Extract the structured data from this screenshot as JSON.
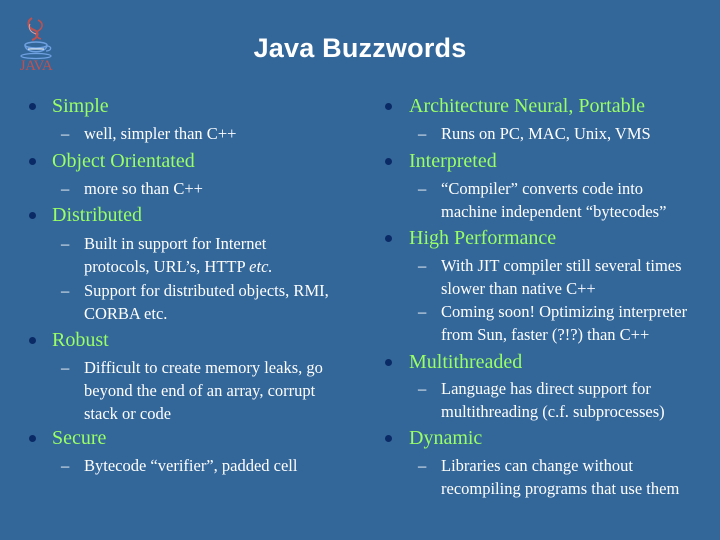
{
  "slide": {
    "title": "Java Buzzwords",
    "logo_text": "JAVA",
    "colors": {
      "background": "#336699",
      "heading": "#99ff66",
      "body": "#ffffff",
      "bullet": "#0a2a66"
    }
  },
  "left_column": [
    {
      "heading": "Simple",
      "subitems": [
        "well, simpler than C++"
      ]
    },
    {
      "heading": "Object Orientated",
      "subitems": [
        "more so than C++"
      ]
    },
    {
      "heading": "Distributed",
      "subitems": [
        "Built in support for Internet protocols, URL’s, HTTP etc.",
        "Support for distributed objects, RMI, CORBA etc."
      ]
    },
    {
      "heading": "Robust",
      "subitems": [
        "Difficult to create memory leaks, go beyond the end of an array, corrupt stack or code"
      ]
    },
    {
      "heading": "Secure",
      "subitems": [
        "Bytecode “verifier”, padded cell"
      ]
    }
  ],
  "right_column": [
    {
      "heading": "Architecture Neural, Portable",
      "subitems": [
        "Runs on PC, MAC, Unix, VMS"
      ]
    },
    {
      "heading": "Interpreted",
      "subitems": [
        "“Compiler” converts code into machine independent “bytecodes”"
      ]
    },
    {
      "heading": "High Performance",
      "subitems": [
        "With JIT compiler still several times slower than native C++",
        "Coming soon! Optimizing interpreter from Sun, faster (?!?) than C++"
      ]
    },
    {
      "heading": "Multithreaded",
      "subitems": [
        "Language has direct support for multithreading (c.f. subprocesses)"
      ]
    },
    {
      "heading": "Dynamic",
      "subitems": [
        "Libraries can change without recompiling programs that use them"
      ]
    }
  ],
  "dash_glyph": "–"
}
